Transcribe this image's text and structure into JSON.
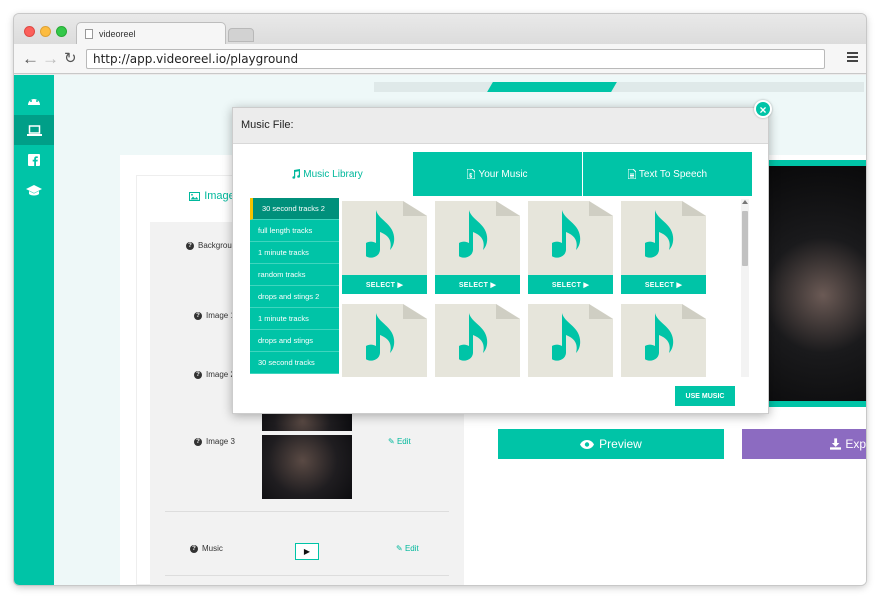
{
  "browser": {
    "tab_title": "videoreel",
    "url": "http://app.videoreel.io/playground"
  },
  "sidebar": {
    "icons": [
      "dashboard-icon",
      "laptop-icon",
      "facebook-icon",
      "graduation-cap-icon"
    ],
    "active_index": 1
  },
  "editor": {
    "image_tab_label": "Image",
    "rows": [
      {
        "label": "Backgrou"
      },
      {
        "label": "Image 1"
      },
      {
        "label": "Image 2"
      },
      {
        "label": "Image 3",
        "edit_label": "Edit"
      },
      {
        "label": "Music",
        "edit_label": "Edit",
        "play_symbol": "▶"
      }
    ],
    "preview_label": "Preview",
    "export_label": "Exp"
  },
  "modal": {
    "title": "Music File:",
    "close_symbol": "×",
    "tabs": [
      {
        "label": "Music Library",
        "icon": "music-icon",
        "active": true
      },
      {
        "label": "Your Music",
        "icon": "file-audio-icon",
        "active": false
      },
      {
        "label": "Text To Speech",
        "icon": "file-text-icon",
        "active": false
      }
    ],
    "categories": [
      {
        "label": "30 second tracks 2",
        "active": true
      },
      {
        "label": "full length tracks"
      },
      {
        "label": "1 minute tracks"
      },
      {
        "label": "random tracks"
      },
      {
        "label": "drops and stings 2"
      },
      {
        "label": "1 minute tracks"
      },
      {
        "label": "drops and stings"
      },
      {
        "label": "30 second tracks"
      }
    ],
    "select_label": "SELECT ▶",
    "use_music_label": "USE MUSIC"
  },
  "colors": {
    "accent": "#00c4a7",
    "accent_dark": "#00907b",
    "export": "#8c6bc1",
    "highlight": "#f5c400"
  }
}
